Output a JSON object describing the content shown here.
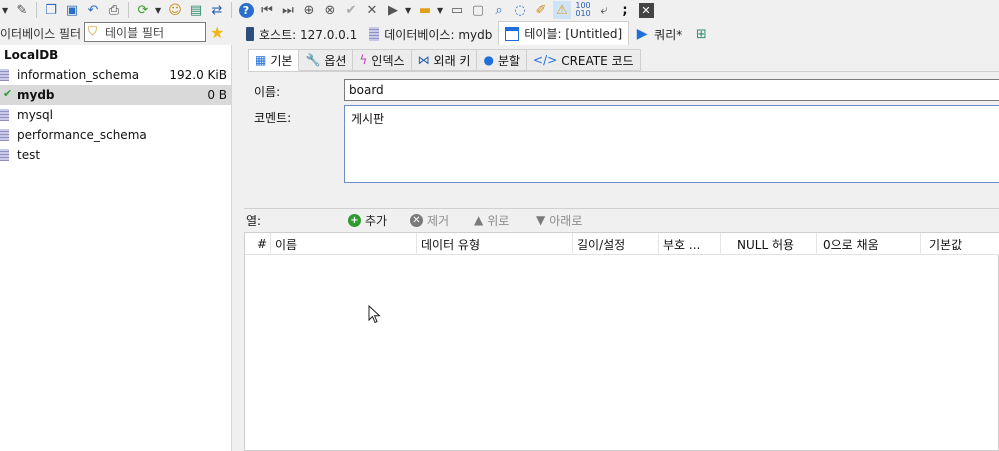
{
  "toolbar": {
    "icons": [
      "connect-icon",
      "wand-icon",
      "copy-icon",
      "paste-icon",
      "undo-icon",
      "print-icon",
      "refresh-icon",
      "users-icon",
      "export-icon",
      "transfer-icon",
      "help-icon",
      "first-icon",
      "last-icon",
      "add-icon",
      "remove-icon",
      "check-icon",
      "cancel-icon",
      "run-icon",
      "folder-icon",
      "save-icon",
      "disconnect-icon",
      "search-icon",
      "find-replace-icon",
      "clean-icon",
      "warning-icon",
      "binary-icon",
      "wrap-icon",
      "semicolon-icon",
      "close-icon"
    ]
  },
  "filters": {
    "database_filter": "이터베이스 필터",
    "table_filter": "테이블 필터"
  },
  "tree": {
    "root": "LocalDB",
    "items": [
      {
        "name": "information_schema",
        "size": "192.0 KiB"
      },
      {
        "name": "mydb",
        "size": "0 B"
      },
      {
        "name": "mysql",
        "size": ""
      },
      {
        "name": "performance_schema",
        "size": ""
      },
      {
        "name": "test",
        "size": ""
      }
    ]
  },
  "tabs": {
    "host": "호스트: 127.0.0.1",
    "database": "데이터베이스: mydb",
    "table": "테이블: [Untitled]",
    "query": "쿼리*"
  },
  "subtabs": [
    "기본",
    "옵션",
    "인덱스",
    "외래 키",
    "분할",
    "CREATE 코드"
  ],
  "basic": {
    "name_label": "이름:",
    "name_value": "board",
    "comment_label": "코멘트:",
    "comment_value": "게시판"
  },
  "columns": {
    "label": "열:",
    "add": "추가",
    "remove": "제거",
    "up": "위로",
    "down": "아래로",
    "headers": [
      "#",
      "이름",
      "데이터 유형",
      "길이/설정",
      "부호 ...",
      "NULL 허용",
      "0으로 채움",
      "기본값"
    ]
  },
  "colors": {
    "accent_blue": "#1e6fd9",
    "add_green": "#2e9b2e",
    "selected_row": "#d9d9d9"
  }
}
